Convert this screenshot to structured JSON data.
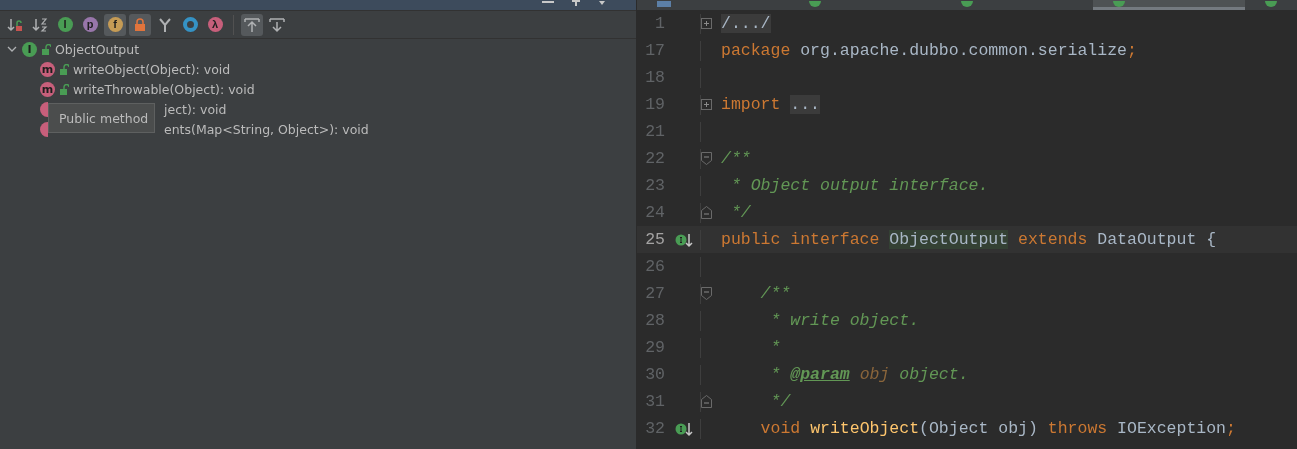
{
  "structure": {
    "toolbar": [
      {
        "kind": "sort-visibility",
        "selected": false
      },
      {
        "kind": "sort-alpha",
        "selected": false
      },
      {
        "kind": "inherited",
        "glyph": "I",
        "color": "#499c54",
        "selected": false
      },
      {
        "kind": "circle",
        "glyph": "p",
        "color": "#9876aa",
        "selected": false
      },
      {
        "kind": "circle",
        "glyph": "f",
        "color": "#c59b55",
        "selected": true
      },
      {
        "kind": "lock",
        "selected": true
      },
      {
        "kind": "fork",
        "selected": false
      },
      {
        "kind": "ring",
        "color": "#3592c4",
        "selected": false
      },
      {
        "kind": "circle",
        "glyph": "λ",
        "color": "#c75f7b",
        "selected": false
      },
      {
        "kind": "separator"
      },
      {
        "kind": "scroll-to",
        "selected": true
      },
      {
        "kind": "scroll-from",
        "selected": false
      }
    ],
    "tree": {
      "glyph": "I",
      "color": "#499c54",
      "label": "ObjectOutput",
      "expanded": true,
      "children": [
        {
          "glyph": "m",
          "color": "#c75f7b",
          "label": "writeObject(Object): void",
          "covered": false
        },
        {
          "glyph": "m",
          "color": "#c75f7b",
          "label": "writeThrowable(Object): void",
          "covered": false
        },
        {
          "color": "#c75f7b",
          "label": "ject): void",
          "covered": true
        },
        {
          "color": "#c75f7b",
          "label": "ents(Map<String, Object>): void",
          "covered": true
        }
      ]
    },
    "tooltip": "Public method"
  },
  "editor": {
    "tabs": [
      {
        "kind": "md",
        "selected": false
      },
      {
        "kind": "java",
        "selected": false
      },
      {
        "kind": "java",
        "selected": false
      },
      {
        "kind": "java",
        "selected": true
      },
      {
        "kind": "java",
        "selected": false
      }
    ],
    "lines": [
      {
        "num": "1",
        "fold": {
          "kind": "plus"
        },
        "tokens": [
          {
            "kind": "folded",
            "text": "/.../"
          }
        ]
      },
      {
        "num": "17",
        "tokens": [
          {
            "kind": "kw",
            "text": "package "
          },
          {
            "kind": "plain",
            "text": "org.apache.dubbo.common.serialize"
          },
          {
            "kind": "kw",
            "text": ";"
          }
        ]
      },
      {
        "num": "18"
      },
      {
        "num": "19",
        "fold": {
          "kind": "plus"
        },
        "tokens": [
          {
            "kind": "kw",
            "text": "import "
          },
          {
            "kind": "folded",
            "text": "..."
          }
        ]
      },
      {
        "num": "21"
      },
      {
        "num": "22",
        "fold": {
          "kind": "start"
        },
        "tokens": [
          {
            "kind": "comment",
            "text": "/**"
          }
        ]
      },
      {
        "num": "23",
        "tokens": [
          {
            "kind": "comment",
            "text": " * Object output interface."
          }
        ]
      },
      {
        "num": "24",
        "fold": {
          "kind": "end"
        },
        "tokens": [
          {
            "kind": "comment",
            "text": " */"
          }
        ]
      },
      {
        "num": "25",
        "marker": {
          "kind": "implemented"
        },
        "current": true,
        "tokens": [
          {
            "kind": "kw",
            "text": "public interface "
          },
          {
            "kind": "highlight",
            "text": "ObjectOutput"
          },
          {
            "kind": "kw",
            "text": " extends "
          },
          {
            "kind": "plain",
            "text": "DataOutput {"
          }
        ]
      },
      {
        "num": "26"
      },
      {
        "num": "27",
        "fold": {
          "kind": "start"
        },
        "tokens": [
          {
            "kind": "comment",
            "text": "    /**"
          }
        ]
      },
      {
        "num": "28",
        "tokens": [
          {
            "kind": "comment",
            "text": "     * write object."
          }
        ]
      },
      {
        "num": "29",
        "tokens": [
          {
            "kind": "comment",
            "text": "     *"
          }
        ]
      },
      {
        "num": "30",
        "tokens": [
          {
            "kind": "comment",
            "text": "     * "
          },
          {
            "kind": "tag",
            "text": "@param"
          },
          {
            "kind": "param",
            "text": " obj"
          },
          {
            "kind": "comment",
            "text": " object."
          }
        ]
      },
      {
        "num": "31",
        "fold": {
          "kind": "end"
        },
        "tokens": [
          {
            "kind": "comment",
            "text": "     */"
          }
        ]
      },
      {
        "num": "32",
        "marker": {
          "kind": "implemented"
        },
        "tokens": [
          {
            "kind": "kw",
            "text": "    void "
          },
          {
            "kind": "fn",
            "text": "writeObject"
          },
          {
            "kind": "plain",
            "text": "(Object obj) "
          },
          {
            "kind": "kw",
            "text": "throws "
          },
          {
            "kind": "plain",
            "text": "IOException"
          },
          {
            "kind": "kw",
            "text": ";"
          }
        ]
      }
    ]
  }
}
